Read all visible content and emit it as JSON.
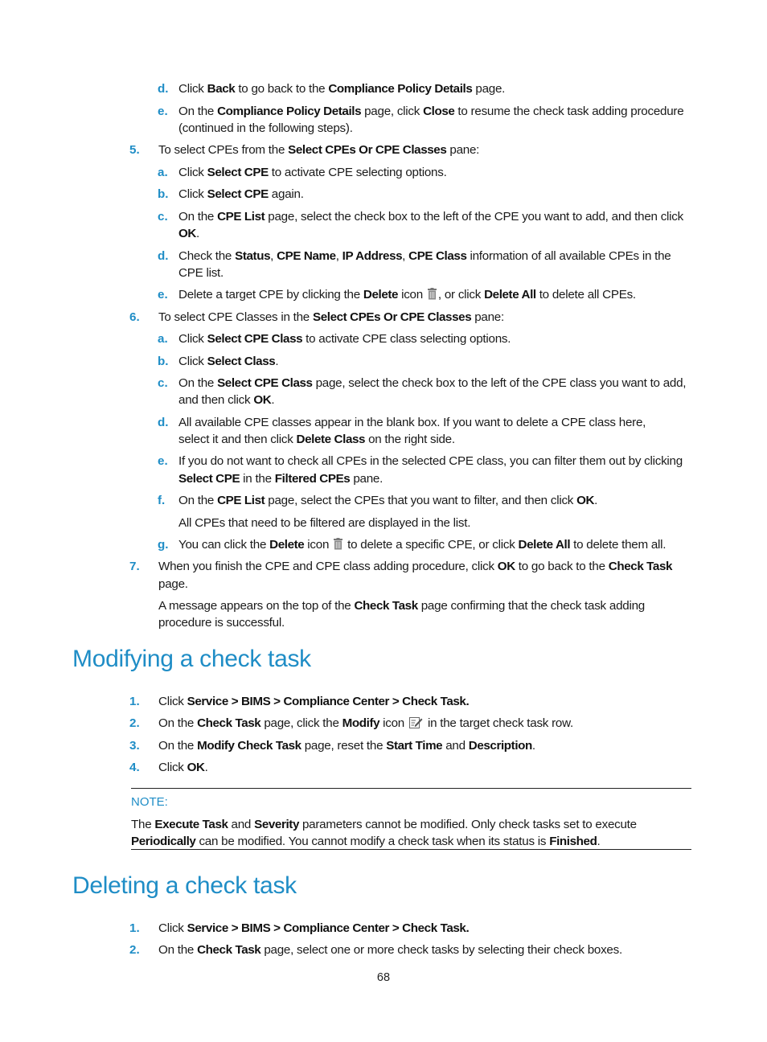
{
  "continued_steps": {
    "substeps_4": [
      {
        "marker": "d.",
        "parts": [
          "Click ",
          "*Back",
          " to go back to the ",
          "*Compliance Policy Details",
          " page."
        ]
      },
      {
        "marker": "e.",
        "lines": [
          [
            "On the ",
            "*Compliance Policy Details",
            " page, click ",
            "*Close",
            " to resume the check task adding procedure"
          ],
          [
            "(continued in the following steps)."
          ]
        ]
      }
    ],
    "step5": {
      "marker": "5.",
      "parts": [
        "To select CPEs from the ",
        "*Select CPEs Or CPE Classes",
        " pane:"
      ]
    },
    "step5_sub": [
      {
        "marker": "a.",
        "parts": [
          "Click ",
          "*Select CPE",
          " to activate CPE selecting options."
        ]
      },
      {
        "marker": "b.",
        "parts": [
          "Click ",
          "*Select CPE",
          " again."
        ]
      },
      {
        "marker": "c.",
        "lines": [
          [
            "On the ",
            "*CPE List",
            " page, select the check box to the left of the CPE you want to add, and then click"
          ],
          [
            "*OK",
            "."
          ]
        ]
      },
      {
        "marker": "d.",
        "lines": [
          [
            "Check the ",
            "*Status",
            ", ",
            "*CPE Name",
            ", ",
            "*IP Address",
            ", ",
            "*CPE Class",
            " information of all available CPEs in the"
          ],
          [
            "CPE list."
          ]
        ]
      },
      {
        "marker": "e.",
        "parts": [
          "Delete a target CPE by clicking the ",
          "*Delete",
          " icon ",
          "#trash",
          ", or click ",
          "*Delete All",
          " to delete all CPEs."
        ]
      }
    ],
    "step6": {
      "marker": "6.",
      "parts": [
        "To select CPE Classes in the ",
        "*Select CPEs Or CPE Classes",
        " pane:"
      ]
    },
    "step6_sub": [
      {
        "marker": "a.",
        "parts": [
          "Click ",
          "*Select CPE Class",
          " to activate CPE class selecting options."
        ]
      },
      {
        "marker": "b.",
        "parts": [
          "Click ",
          "*Select Class",
          "."
        ]
      },
      {
        "marker": "c.",
        "lines": [
          [
            "On the ",
            "*Select CPE Class",
            " page, select the check box to the left of the CPE class you want to add,"
          ],
          [
            "and then click ",
            "*OK",
            "."
          ]
        ]
      },
      {
        "marker": "d.",
        "lines": [
          [
            "All available CPE classes appear in the blank box. If you want to delete a CPE class here,"
          ],
          [
            "select it and then click ",
            "*Delete Class",
            " on the right side."
          ]
        ]
      },
      {
        "marker": "e.",
        "lines": [
          [
            "If you do not want to check all CPEs in the selected CPE class, you can filter them out by clicking"
          ],
          [
            "*Select CPE",
            " in the ",
            "*Filtered CPEs",
            " pane."
          ]
        ]
      },
      {
        "marker": "f.",
        "lines": [
          [
            "On the ",
            "*CPE List",
            " page, select the CPEs that you want to filter, and then click ",
            "*OK",
            "."
          ],
          [
            "All CPEs that need to be filtered are displayed in the list."
          ]
        ]
      },
      {
        "marker": "g.",
        "parts": [
          "You can click the ",
          "*Delete",
          " icon ",
          "#trash",
          " to delete a specific CPE, or click ",
          "*Delete All",
          " to delete them all."
        ]
      }
    ],
    "step7": {
      "marker": "7.",
      "lines": [
        [
          "When you finish the CPE and CPE class adding procedure, click ",
          "*OK",
          " to go back to the ",
          "*Check Task"
        ],
        [
          "page."
        ],
        [
          "A message appears on the top of the ",
          "*Check Task",
          " page confirming that the check task adding"
        ],
        [
          "procedure is successful."
        ]
      ]
    }
  },
  "modify_section": {
    "title": "Modifying a check task",
    "steps": [
      {
        "marker": "1.",
        "parts": [
          "Click ",
          "*Service > BIMS > Compliance Center > Check Task."
        ]
      },
      {
        "marker": "2.",
        "parts": [
          "On the ",
          "*Check Task",
          " page, click the ",
          "*Modify",
          " icon ",
          "#edit",
          " in the target check task row."
        ]
      },
      {
        "marker": "3.",
        "parts": [
          "On the ",
          "*Modify Check Task",
          " page, reset the ",
          "*Start Time",
          " and ",
          "*Description",
          "."
        ]
      },
      {
        "marker": "4.",
        "parts": [
          "Click ",
          "*OK",
          "."
        ]
      }
    ],
    "note": {
      "label": "NOTE:",
      "lines": [
        [
          "The ",
          "*Execute Task",
          " and ",
          "*Severity",
          " parameters cannot be modified. Only check tasks set to execute"
        ],
        [
          "*Periodically",
          " can be modified. You cannot modify a check task when its status is ",
          "*Finished",
          "."
        ]
      ]
    }
  },
  "delete_section": {
    "title": "Deleting a check task",
    "steps": [
      {
        "marker": "1.",
        "parts": [
          "Click ",
          "*Service > BIMS > Compliance Center > Check Task."
        ]
      },
      {
        "marker": "2.",
        "parts": [
          "On the ",
          "*Check Task",
          " page, select one or more check tasks by selecting their check boxes."
        ]
      }
    ]
  },
  "page_number": "68",
  "colors": {
    "accent": "#1f8dc6",
    "text": "#1a1a1a"
  }
}
